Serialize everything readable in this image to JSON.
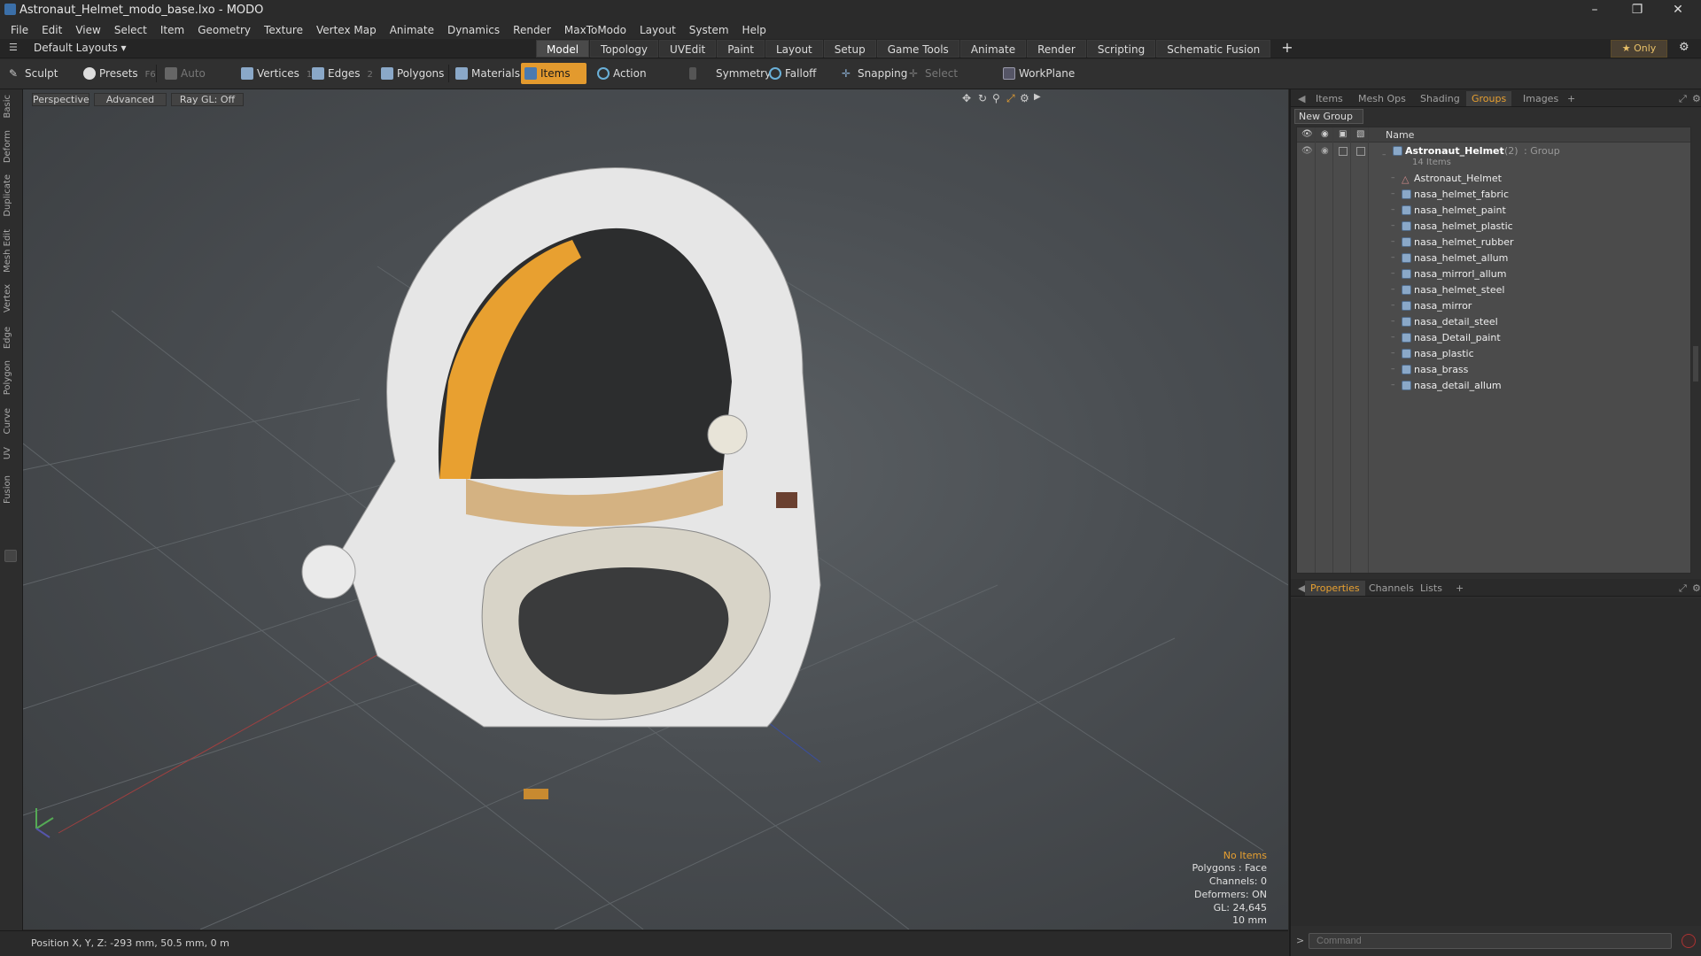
{
  "window": {
    "title": "Astronaut_Helmet_modo_base.lxo - MODO",
    "controls": [
      "minimize-icon",
      "restore-icon",
      "close-icon"
    ]
  },
  "menu": [
    "File",
    "Edit",
    "View",
    "Select",
    "Item",
    "Geometry",
    "Texture",
    "Vertex Map",
    "Animate",
    "Dynamics",
    "Render",
    "MaxToModo",
    "Layout",
    "System",
    "Help"
  ],
  "layoutbar": {
    "default_layouts": "Default Layouts ▾",
    "tabs": [
      "Model",
      "Topology",
      "UVEdit",
      "Paint",
      "Layout",
      "Setup",
      "Game Tools",
      "Animate",
      "Render",
      "Scripting",
      "Schematic Fusion"
    ],
    "active_tab": "Model",
    "plus": "+",
    "only": "★  Only"
  },
  "toolbar": {
    "sculpt": "Sculpt",
    "presets": "Presets",
    "presets_key": "F6",
    "auto_select": "Auto Select",
    "vertices": "Vertices",
    "vertices_key": "1",
    "edges": "Edges",
    "edges_key": "2",
    "polygons": "Polygons",
    "materials": "Materials",
    "items": "Items",
    "action_center": "Action Center",
    "symmetry": "Symmetry",
    "falloff": "Falloff",
    "snapping": "Snapping",
    "select_through": "Select Through",
    "workplane": "WorkPlane"
  },
  "left_tabs": [
    "Basic",
    "Deform",
    "Duplicate",
    "Mesh Edit",
    "Vertex",
    "Edge",
    "Polygon",
    "Curve",
    "UV",
    "Fusion"
  ],
  "viewport": {
    "view": "Perspective",
    "shading": "Advanced",
    "raygl": "Ray GL: Off",
    "hud": [
      "No Items",
      "Polygons : Face",
      "Channels: 0",
      "Deformers: ON",
      "GL: 24,645",
      "10 mm"
    ]
  },
  "status": {
    "position": "Position X, Y, Z:  -293 mm, 50.5 mm, 0 m"
  },
  "panel_top": {
    "tabs": [
      "Items",
      "Mesh Ops",
      "Shading",
      "Groups",
      "Images"
    ],
    "active_tab": "Groups",
    "plus": "+",
    "new_group": "New Group",
    "name_header": "Name",
    "group": {
      "name": "Astronaut_Helmet",
      "count": "(2)",
      "type": ": Group",
      "items_label": "14 Items"
    },
    "items": [
      "Astronaut_Helmet",
      "nasa_helmet_fabric",
      "nasa_helmet_paint",
      "nasa_helmet_plastic",
      "nasa_helmet_rubber",
      "nasa_helmet_allum",
      "nasa_mirrorl_allum",
      "nasa_helmet_steel",
      "nasa_mirror",
      "nasa_detail_steel",
      "nasa_Detail_paint",
      "nasa_plastic",
      "nasa_brass",
      "nasa_detail_allum"
    ]
  },
  "panel_bottom": {
    "tabs": [
      "Properties",
      "Channels",
      "Lists"
    ],
    "active_tab": "Properties",
    "plus": "+"
  },
  "command": {
    "placeholder": "Command",
    "prompt": ">"
  },
  "colors": {
    "accent": "#e39a2e",
    "viewport_bg": "#4a4e52",
    "panel_bg": "#2e2e2e",
    "list_bg": "#4b4b4b"
  }
}
